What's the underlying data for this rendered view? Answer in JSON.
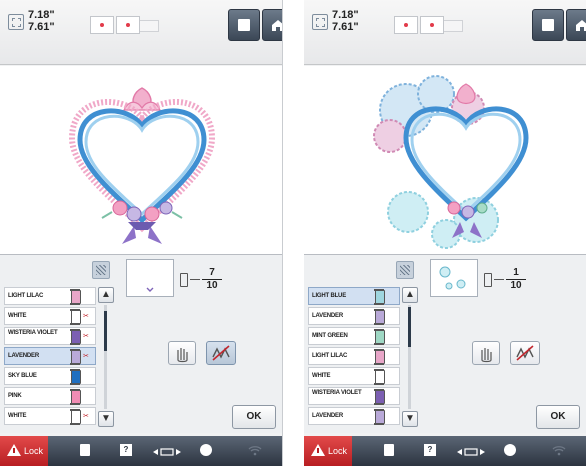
{
  "colors": {
    "accent": "#3b4756",
    "lock_red": "#c8252a",
    "selection": "#d2e0f2"
  },
  "screens": [
    {
      "id": "left",
      "size": {
        "width": "7.18",
        "height": "7.61",
        "unit": "\""
      },
      "counter": {
        "current": "7",
        "total": "10"
      },
      "threads": [
        {
          "name": "LIGHT LILAC",
          "color": "#e8a6c8",
          "needle": false,
          "selected": false
        },
        {
          "name": "WHITE",
          "color": "#ffffff",
          "needle": true,
          "selected": false
        },
        {
          "name": "WISTERIA VIOLET",
          "color": "#7c5fb2",
          "needle": true,
          "selected": false
        },
        {
          "name": "LAVENDER",
          "color": "#b9a9d8",
          "needle": true,
          "selected": true
        },
        {
          "name": "SKY BLUE",
          "color": "#1f6fc0",
          "needle": false,
          "selected": false
        },
        {
          "name": "PINK",
          "color": "#f08cb4",
          "needle": false,
          "selected": false
        },
        {
          "name": "WHITE",
          "color": "#ffffff",
          "needle": true,
          "selected": false
        }
      ],
      "ok_label": "OK",
      "lock_label": "Lock"
    },
    {
      "id": "right",
      "size": {
        "width": "7.18",
        "height": "7.61",
        "unit": "\""
      },
      "counter": {
        "current": "1",
        "total": "10"
      },
      "threads": [
        {
          "name": "LIGHT BLUE",
          "color": "#9fd6df",
          "needle": false,
          "selected": true
        },
        {
          "name": "LAVENDER",
          "color": "#b9a9d8",
          "needle": false,
          "selected": false
        },
        {
          "name": "MINT GREEN",
          "color": "#9fd8c4",
          "needle": false,
          "selected": false
        },
        {
          "name": "LIGHT LILAC",
          "color": "#e8a6c8",
          "needle": false,
          "selected": false
        },
        {
          "name": "WHITE",
          "color": "#ffffff",
          "needle": false,
          "selected": false
        },
        {
          "name": "WISTERIA VIOLET",
          "color": "#7c5fb2",
          "needle": false,
          "selected": false
        },
        {
          "name": "LAVENDER",
          "color": "#b9a9d8",
          "needle": false,
          "selected": false
        }
      ],
      "ok_label": "OK",
      "lock_label": "Lock"
    }
  ],
  "icons": {
    "size": "size-icon",
    "frame": "frame-icon",
    "single_color": "square-icon",
    "home": "home-icon",
    "magnify": "magnify-icon",
    "spool": "spool-icon",
    "needle": "needle-icon",
    "hand": "hand-icon",
    "no_trim": "no-trim-icon",
    "scroll_up": "chevron-up-icon",
    "scroll_down": "chevron-down-icon",
    "lock": "warning-icon",
    "doc": "document-icon",
    "help": "help-icon",
    "embroidery": "embroidery-unit-icon",
    "needle_mode": "needle-mode-icon",
    "wifi": "wifi-icon"
  }
}
